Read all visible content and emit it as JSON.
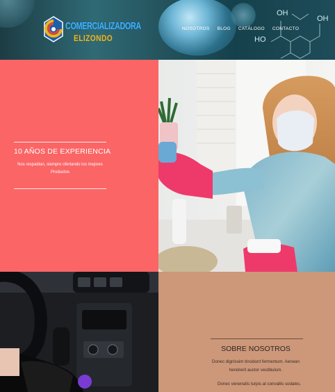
{
  "brand": {
    "name": "COMERCIALIZADORA",
    "subname": "ELIZONDO"
  },
  "nav": {
    "items": [
      "NOSOTROS",
      "BLOG",
      "CATÁLOGO",
      "CONTACTO"
    ]
  },
  "experience": {
    "title": "10 AÑOS DE EXPERIENCIA",
    "text": "Nos respaldan, siempre ofertando los mejores Productos"
  },
  "about": {
    "title": "SOBRE NOSOTROS",
    "paragraph1": "Donec dignissim tincidunt fermentum. Aenean hendrerit auctor vestibulum.",
    "paragraph2": "Donec venenatis turpis at convallis sodales."
  },
  "header_molecule": {
    "oh_top": "OH",
    "oh_right": "OH",
    "ho_left": "HO"
  },
  "colors": {
    "salmon": "#fb6566",
    "tan": "#cd9779",
    "brand_blue": "#3fb2ff",
    "brand_gold": "#f5b21a"
  }
}
